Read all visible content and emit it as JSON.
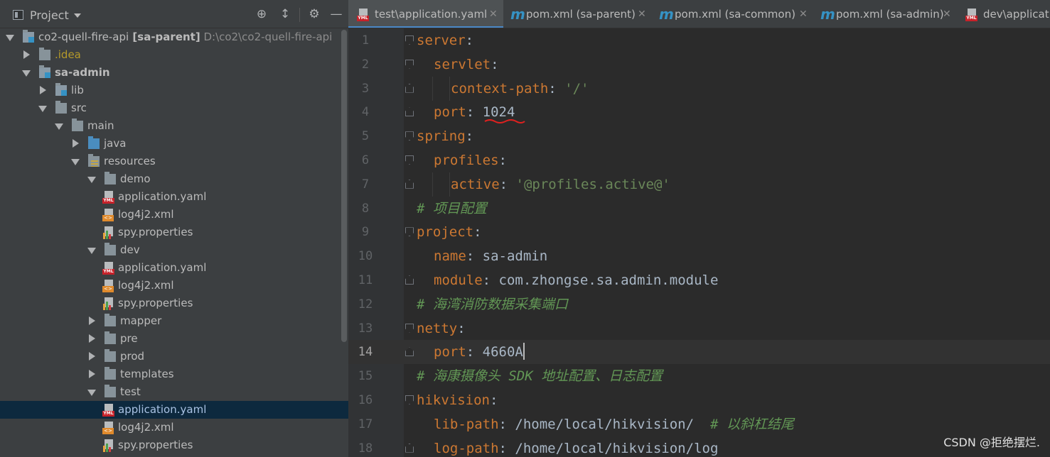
{
  "project_panel": {
    "title": "Project",
    "icons": [
      "project-icon",
      "locate-icon",
      "collapse-icon",
      "gear-icon",
      "minimize-icon"
    ],
    "tree": [
      {
        "label": "co2-quell-fire-api",
        "suffix": "[sa-parent]",
        "path": "D:\\co2\\co2-quell-fire-api",
        "depth": 0,
        "state": "open",
        "icon": "module-folder"
      },
      {
        "label": ".idea",
        "depth": 1,
        "state": "closed",
        "icon": "folder"
      },
      {
        "label": "sa-admin",
        "depth": 1,
        "state": "open",
        "icon": "module-folder"
      },
      {
        "label": "lib",
        "depth": 2,
        "state": "closed",
        "icon": "module-folder"
      },
      {
        "label": "src",
        "depth": 2,
        "state": "open",
        "icon": "folder"
      },
      {
        "label": "main",
        "depth": 3,
        "state": "open",
        "icon": "folder"
      },
      {
        "label": "java",
        "depth": 4,
        "state": "closed",
        "icon": "java-folder"
      },
      {
        "label": "resources",
        "depth": 4,
        "state": "open",
        "icon": "resources-folder"
      },
      {
        "label": "demo",
        "depth": 5,
        "state": "open",
        "icon": "folder"
      },
      {
        "label": "application.yaml",
        "depth": 6,
        "state": "leaf",
        "icon": "yaml-file"
      },
      {
        "label": "log4j2.xml",
        "depth": 6,
        "state": "leaf",
        "icon": "xml-file"
      },
      {
        "label": "spy.properties",
        "depth": 6,
        "state": "leaf",
        "icon": "properties-file"
      },
      {
        "label": "dev",
        "depth": 5,
        "state": "open",
        "icon": "folder"
      },
      {
        "label": "application.yaml",
        "depth": 6,
        "state": "leaf",
        "icon": "yaml-file"
      },
      {
        "label": "log4j2.xml",
        "depth": 6,
        "state": "leaf",
        "icon": "xml-file"
      },
      {
        "label": "spy.properties",
        "depth": 6,
        "state": "leaf",
        "icon": "properties-file"
      },
      {
        "label": "mapper",
        "depth": 5,
        "state": "closed",
        "icon": "folder"
      },
      {
        "label": "pre",
        "depth": 5,
        "state": "closed",
        "icon": "folder"
      },
      {
        "label": "prod",
        "depth": 5,
        "state": "closed",
        "icon": "folder"
      },
      {
        "label": "templates",
        "depth": 5,
        "state": "closed",
        "icon": "folder"
      },
      {
        "label": "test",
        "depth": 5,
        "state": "open",
        "icon": "folder"
      },
      {
        "label": "application.yaml",
        "depth": 6,
        "state": "leaf",
        "icon": "yaml-file",
        "selected": true
      },
      {
        "label": "log4j2.xml",
        "depth": 6,
        "state": "leaf",
        "icon": "xml-file"
      },
      {
        "label": "spy.properties",
        "depth": 6,
        "state": "leaf",
        "icon": "properties-file"
      }
    ]
  },
  "editor": {
    "tabs": [
      {
        "label": "test\\application.yaml",
        "icon": "yaml-file-icon",
        "active": true,
        "closable": true
      },
      {
        "label": "pom.xml (sa-parent)",
        "icon": "maven-icon",
        "active": false,
        "closable": true
      },
      {
        "label": "pom.xml (sa-common)",
        "icon": "maven-icon",
        "active": false,
        "closable": true
      },
      {
        "label": "pom.xml (sa-admin)",
        "icon": "maven-icon",
        "active": false,
        "closable": true
      },
      {
        "label": "dev\\applicati",
        "icon": "yaml-file-icon",
        "active": false,
        "closable": false
      }
    ],
    "current_line": 14,
    "lines": [
      {
        "n": "1",
        "indent": 0,
        "fold": "start",
        "key": "server",
        "sep": ":",
        "val": "",
        "vtype": "",
        "comment": ""
      },
      {
        "n": "2",
        "indent": 1,
        "fold": "start",
        "key": "servlet",
        "sep": ":",
        "val": "",
        "vtype": "",
        "comment": ""
      },
      {
        "n": "3",
        "indent": 2,
        "fold": "end",
        "key": "context-path",
        "sep": ": ",
        "val": "'/'",
        "vtype": "s",
        "comment": ""
      },
      {
        "n": "4",
        "indent": 1,
        "fold": "end",
        "key": "port",
        "sep": ": ",
        "val": "1024",
        "vtype": "n",
        "comment": ""
      },
      {
        "n": "5",
        "indent": 0,
        "fold": "start",
        "key": "spring",
        "sep": ":",
        "val": "",
        "vtype": "",
        "comment": ""
      },
      {
        "n": "6",
        "indent": 1,
        "fold": "start",
        "key": "profiles",
        "sep": ":",
        "val": "",
        "vtype": "",
        "comment": ""
      },
      {
        "n": "7",
        "indent": 2,
        "fold": "end",
        "key": "active",
        "sep": ": ",
        "val": "'@profiles.active@'",
        "vtype": "s",
        "comment": ""
      },
      {
        "n": "8",
        "indent": 0,
        "fold": "",
        "key": "",
        "sep": "",
        "val": "",
        "vtype": "",
        "comment": "# 项目配置"
      },
      {
        "n": "9",
        "indent": 0,
        "fold": "start",
        "key": "project",
        "sep": ":",
        "val": "",
        "vtype": "",
        "comment": ""
      },
      {
        "n": "10",
        "indent": 1,
        "fold": "",
        "key": "name",
        "sep": ": ",
        "val": "sa-admin",
        "vtype": "n",
        "comment": ""
      },
      {
        "n": "11",
        "indent": 1,
        "fold": "end",
        "key": "module",
        "sep": ": ",
        "val": "com.zhongse.sa.admin.module",
        "vtype": "n",
        "comment": ""
      },
      {
        "n": "12",
        "indent": 0,
        "fold": "",
        "key": "",
        "sep": "",
        "val": "",
        "vtype": "",
        "comment": "# 海湾消防数据采集端口"
      },
      {
        "n": "13",
        "indent": 0,
        "fold": "start",
        "key": "netty",
        "sep": ":",
        "val": "",
        "vtype": "",
        "comment": ""
      },
      {
        "n": "14",
        "indent": 1,
        "fold": "end",
        "key": "port",
        "sep": ": ",
        "val": "4660A",
        "vtype": "n",
        "comment": ""
      },
      {
        "n": "15",
        "indent": 0,
        "fold": "",
        "key": "",
        "sep": "",
        "val": "",
        "vtype": "",
        "comment": "# 海康摄像头 SDK 地址配置、日志配置"
      },
      {
        "n": "16",
        "indent": 0,
        "fold": "start",
        "key": "hikvision",
        "sep": ":",
        "val": "",
        "vtype": "",
        "comment": ""
      },
      {
        "n": "17",
        "indent": 1,
        "fold": "",
        "key": "lib-path",
        "sep": ": ",
        "val": "/home/local/hikvision/",
        "vtype": "n",
        "comment": "  # 以斜杠结尾"
      },
      {
        "n": "18",
        "indent": 1,
        "fold": "end",
        "key": "log-path",
        "sep": ": ",
        "val": "/home/local/hikvision/log",
        "vtype": "n",
        "comment": ""
      }
    ]
  },
  "watermark": "CSDN @拒绝摆烂.",
  "colors": {
    "key": "#cc7832",
    "string": "#6a8759",
    "comment": "#629755",
    "plain": "#a9b7c6",
    "selection": "#0d293e",
    "underline": "#e0211f"
  }
}
